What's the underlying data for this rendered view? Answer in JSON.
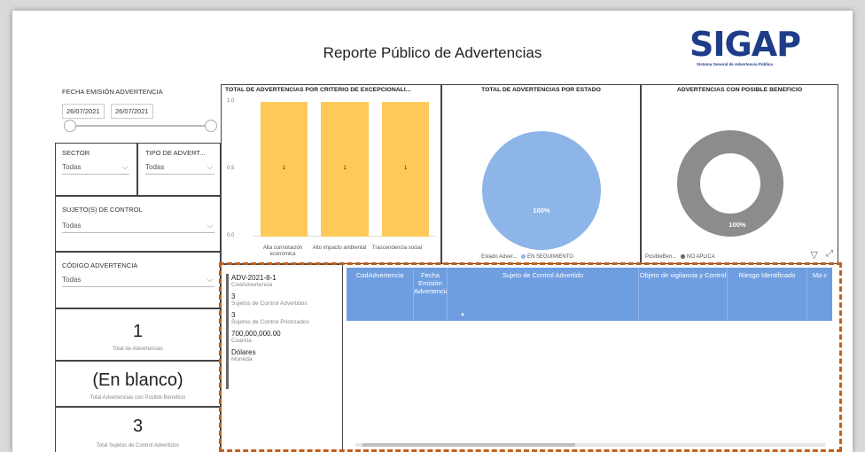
{
  "report": {
    "title": "Reporte Público de Advertencias",
    "logo_text": "SIGAP",
    "logo_subtitle": "Sistema General de Advertencia Pública"
  },
  "filters": {
    "fecha_label": "FECHA EMISIÓN ADVERTENCIA",
    "fecha_desde": "26/07/2021",
    "fecha_hasta": "26/07/2021",
    "sector_label": "SECTOR",
    "sector_value": "Todas",
    "tipo_label": "TIPO DE ADVERT...",
    "tipo_value": "Todas",
    "sujetos_label": "SUJETO(S) DE CONTROL",
    "sujetos_value": "Todas",
    "codigo_label": "CÓDIGO ADVERTENCIA",
    "codigo_value": "Todas"
  },
  "kpis": [
    {
      "value": "1",
      "label": "Total de Advertencias"
    },
    {
      "value": "(En blanco)",
      "label": "Total Advertencias con Posible Beneficio"
    },
    {
      "value": "3",
      "label": "Total Sujetos de Control Advertidos"
    }
  ],
  "bar_chart": {
    "title": "TOTAL DE ADVERTENCIAS POR CRITERIO DE EXCEPCIONALI...",
    "yticks": [
      "1.0",
      "0.5",
      "0.0"
    ],
    "bars": [
      {
        "label": "Alta connotación económica",
        "value": 1,
        "data_label": "1"
      },
      {
        "label": "Alto impacto ambiental",
        "value": 1,
        "data_label": "1"
      },
      {
        "label": "Trascendencia social",
        "value": 1,
        "data_label": "1"
      }
    ]
  },
  "pie_chart": {
    "title": "TOTAL DE ADVERTENCIAS POR ESTADO",
    "slice_label": "100%",
    "legend_title": "Estado Adver...",
    "legend_item": "EN SEGUIMIENTO",
    "color": "#8db5e8"
  },
  "donut_chart": {
    "title": "ADVERTENCIAS CON POSIBLE BENEFICIO",
    "slice_label": "100%",
    "legend_title": "PosibleBen...",
    "legend_item": "NO APLICA",
    "color": "#8c8c8c"
  },
  "multirow_card": {
    "fields": [
      {
        "value": "ADV-2021-8-1",
        "label": "CodAdvertencia"
      },
      {
        "value": "3",
        "label": "Sujetos de Control Advertidos"
      },
      {
        "value": "3",
        "label": "Sujetos de Control Priorizados"
      },
      {
        "value": "700,000,000.00",
        "label": "Cuantía"
      },
      {
        "value": "Dólares",
        "label": "Moneda"
      }
    ]
  },
  "table": {
    "columns": [
      "CodAdvertencia",
      "Fecha Emisión Advertencia",
      "Sujeto de Control Advertido",
      "Objeto de vigilancia y Control",
      "Riesgo Identificado",
      "Ma c"
    ],
    "header_color": "#6f9ee0"
  },
  "chart_data": [
    {
      "type": "bar",
      "title": "TOTAL DE ADVERTENCIAS POR CRITERIO DE EXCEPCIONALI...",
      "categories": [
        "Alta connotación económica",
        "Alto impacto ambiental",
        "Trascendencia social"
      ],
      "values": [
        1,
        1,
        1
      ],
      "ylim": [
        0,
        1
      ],
      "color": "#ffc95a"
    },
    {
      "type": "pie",
      "title": "TOTAL DE ADVERTENCIAS POR ESTADO",
      "categories": [
        "EN SEGUIMIENTO"
      ],
      "values": [
        100
      ]
    },
    {
      "type": "pie",
      "title": "ADVERTENCIAS CON POSIBLE BENEFICIO",
      "categories": [
        "NO APLICA"
      ],
      "values": [
        100
      ]
    }
  ]
}
